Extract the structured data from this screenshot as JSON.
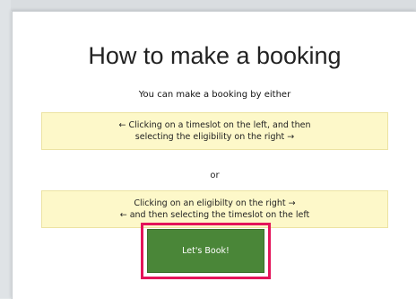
{
  "modal": {
    "title": "How to make a booking",
    "subtitle": "You can make a booking by either",
    "option_one": {
      "line1": "← Clicking on a timeslot on the left, and then",
      "line2": "selecting the eligibility on the right →"
    },
    "separator": "or",
    "option_two": {
      "line1": "Clicking on an eligibilty on the right →",
      "line2": "← and then selecting the timeslot on the left"
    },
    "button_label": "Let's Book!"
  },
  "colors": {
    "button_bg": "#4a8638",
    "highlight_ring": "#e4145a",
    "option_bg": "#fdf8c9"
  }
}
